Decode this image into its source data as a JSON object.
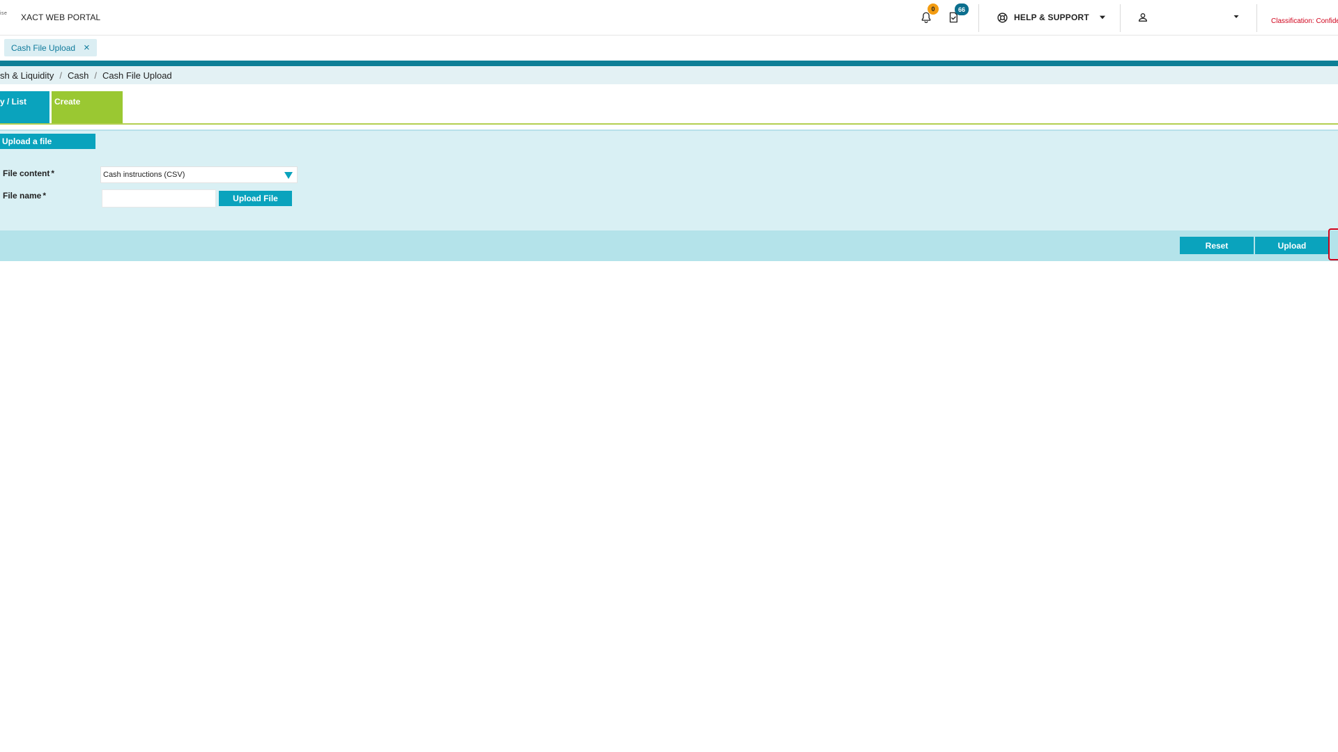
{
  "header": {
    "logo_text": "ise",
    "app_title": "XACT WEB PORTAL",
    "notifications_count": "0",
    "tasks_count": "66",
    "help_label": "HELP & SUPPORT",
    "user_name": "",
    "classification": "Classification: Confide"
  },
  "tabs": {
    "open_tab_label": "Cash File Upload",
    "close_symbol": "×"
  },
  "breadcrumb": {
    "items": [
      "sh & Liquidity",
      "Cash",
      "Cash File Upload"
    ],
    "separator": "/"
  },
  "mode_tabs": {
    "query_label": "y / List",
    "create_label": "Create"
  },
  "form": {
    "section_title": "Upload a file",
    "file_content_label": "File content",
    "file_content_value": "Cash instructions (CSV)",
    "file_name_label": "File name",
    "file_name_value": "",
    "required_mark": "*",
    "upload_file_label": "Upload File"
  },
  "actions": {
    "reset_label": "Reset",
    "upload_label": "Upload"
  },
  "colors": {
    "accent_teal": "#0aa3bd",
    "accent_green": "#9ac832",
    "header_rule": "#0e7f96",
    "classification_red": "#d0021b",
    "badge_orange": "#f39c12",
    "badge_teal": "#0c6f8e"
  },
  "icons": {
    "notifications": "bell-icon",
    "tasks": "task-check-icon",
    "help": "lifebuoy-icon",
    "user": "user-icon",
    "dropdown": "caret-down-icon",
    "close": "close-icon"
  }
}
